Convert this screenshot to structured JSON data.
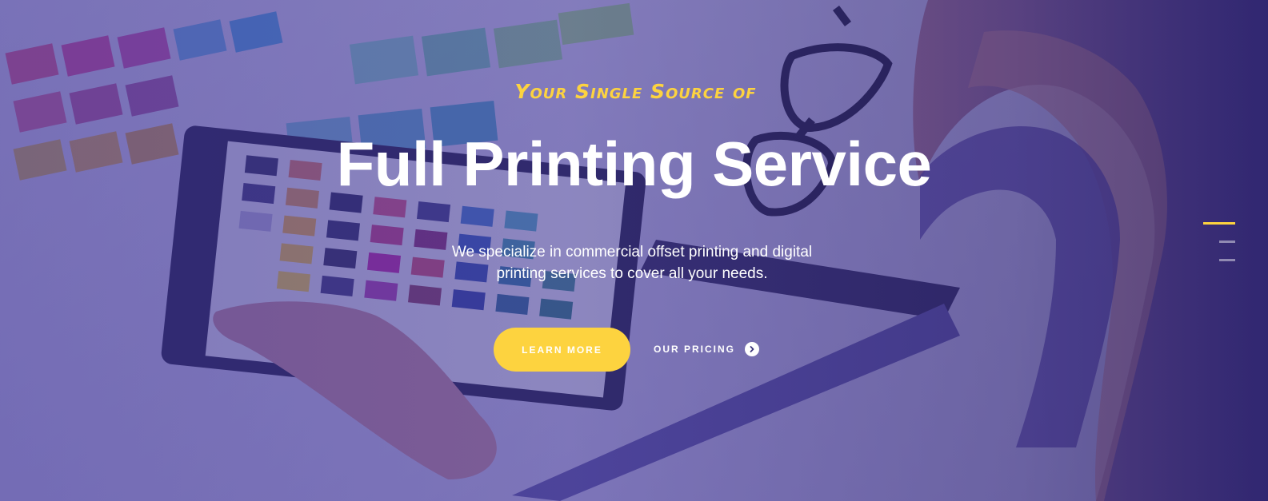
{
  "hero": {
    "eyebrow": "Your Single Source of",
    "title": "Full Printing Service",
    "subtitle": "We specialize in commercial offset printing and digital printing services to cover all your needs.",
    "primary_button": "Learn More",
    "secondary_link": "Our Pricing"
  },
  "slider": {
    "slide_count": 3,
    "active_slide": 1
  },
  "colors": {
    "accent": "#fdd33f",
    "overlay": "#4a3f93",
    "text": "#ffffff"
  },
  "icons": {
    "secondary_link_icon": "chevron-right-circle-icon"
  }
}
